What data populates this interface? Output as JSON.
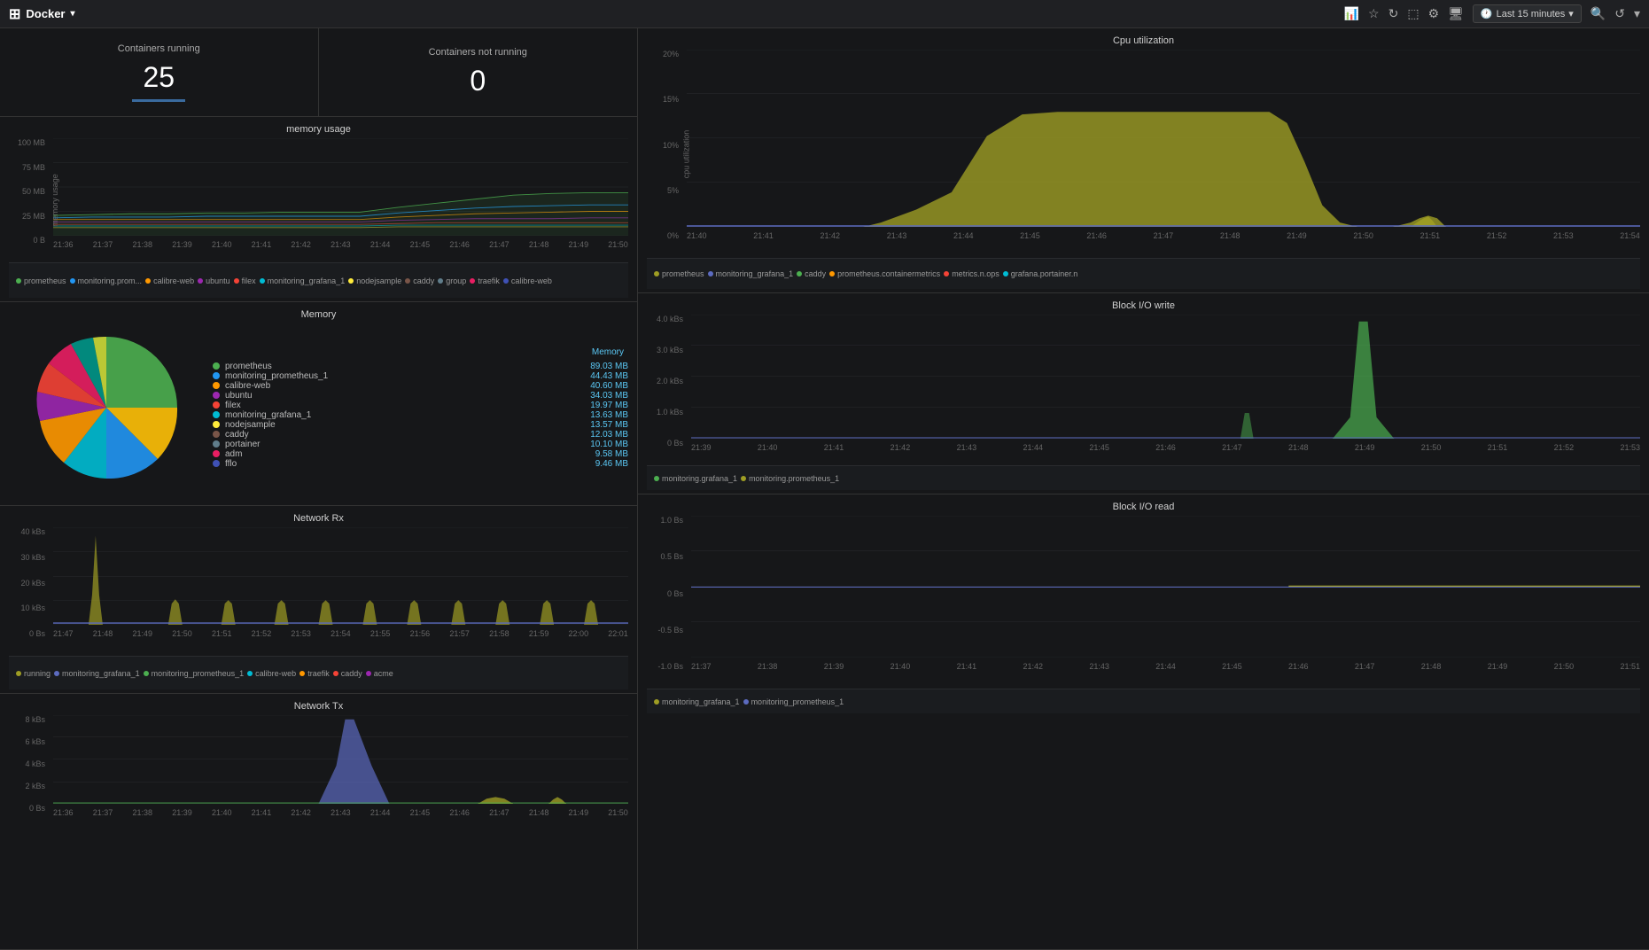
{
  "topbar": {
    "app_name": "Docker",
    "time_range": "Last 15 minutes"
  },
  "stats": {
    "running_label": "Containers running",
    "running_value": "25",
    "not_running_label": "Containers not running",
    "not_running_value": "0"
  },
  "charts": {
    "memory_usage_title": "memory usage",
    "memory_title": "Memory",
    "memory_column": "Memory",
    "network_rx_title": "Network Rx",
    "network_tx_title": "Network Tx",
    "cpu_title": "Cpu utilization",
    "block_write_title": "Block I/O write",
    "block_read_title": "Block I/O read"
  },
  "memory_legend": [
    {
      "name": "prometheus",
      "value": "89.03 MB",
      "color": "#4caf50"
    },
    {
      "name": "monitoring_prometheus_1",
      "value": "44.43 MB",
      "color": "#2196f3"
    },
    {
      "name": "calibre-web",
      "value": "40.60 MB",
      "color": "#ff9800"
    },
    {
      "name": "ubuntu",
      "value": "34.03 MB",
      "color": "#9c27b0"
    },
    {
      "name": "filex",
      "value": "19.97 MB",
      "color": "#f44336"
    },
    {
      "name": "monitoring_grafana_1",
      "value": "13.63 MB",
      "color": "#00bcd4"
    },
    {
      "name": "nodejsample",
      "value": "13.57 MB",
      "color": "#ffeb3b"
    },
    {
      "name": "caddy",
      "value": "12.03 MB",
      "color": "#795548"
    },
    {
      "name": "portainer",
      "value": "10.10 MB",
      "color": "#607d8b"
    },
    {
      "name": "adm",
      "value": "9.58 MB",
      "color": "#e91e63"
    },
    {
      "name": "fflo",
      "value": "9.46 MB",
      "color": "#3f51b5"
    }
  ],
  "memory_x_labels": [
    "21:36",
    "21:37",
    "21:38",
    "21:39",
    "21:40",
    "21:41",
    "21:42",
    "21:43",
    "21:44",
    "21:45",
    "21:46",
    "21:47",
    "21:48",
    "21:49",
    "21:50"
  ],
  "cpu_x_labels": [
    "21:40",
    "21:41",
    "21:42",
    "21:43",
    "21:44",
    "21:45",
    "21:46",
    "21:47",
    "21:48",
    "21:49",
    "21:50",
    "21:51",
    "21:52",
    "21:53",
    "21:54"
  ],
  "cpu_y_labels": [
    "20%",
    "15%",
    "10%",
    "5%",
    "0%"
  ],
  "block_write_x_labels": [
    "21:39",
    "21:40",
    "21:41",
    "21:42",
    "21:43",
    "21:44",
    "21:45",
    "21:46",
    "21:47",
    "21:48",
    "21:49",
    "21:50",
    "21:51",
    "21:52",
    "21:53"
  ],
  "block_write_y_labels": [
    "4.0 kBs",
    "3.0 kBs",
    "2.0 kBs",
    "1.0 kBs",
    "0 Bs"
  ],
  "block_read_x_labels": [
    "21:37",
    "21:38",
    "21:39",
    "21:40",
    "21:41",
    "21:42",
    "21:43",
    "21:44",
    "21:45",
    "21:46",
    "21:47",
    "21:48",
    "21:49",
    "21:50",
    "21:51"
  ],
  "block_read_y_labels": [
    "1.0 Bs",
    "0.5 Bs",
    "0 Bs",
    "-0.5 Bs",
    "-1.0 Bs"
  ],
  "network_rx_x_labels": [
    "21:47",
    "21:48",
    "21:49",
    "21:50",
    "21:51",
    "21:52",
    "21:53",
    "21:54",
    "21:55",
    "21:56",
    "21:57",
    "21:58",
    "21:59",
    "22:00",
    "22:01"
  ],
  "network_rx_y_labels": [
    "40 kBs",
    "30 kBs",
    "20 kBs",
    "10 kBs",
    "0 Bs"
  ],
  "network_tx_x_labels": [
    "21:36",
    "21:37",
    "21:38",
    "21:39",
    "21:40",
    "21:41",
    "21:42",
    "21:43",
    "21:44",
    "21:45",
    "21:46",
    "21:47",
    "21:48",
    "21:49",
    "21:50"
  ],
  "network_tx_y_labels": [
    "8 kBs",
    "6 kBs",
    "4 kBs",
    "2 kBs",
    "0 Bs"
  ]
}
